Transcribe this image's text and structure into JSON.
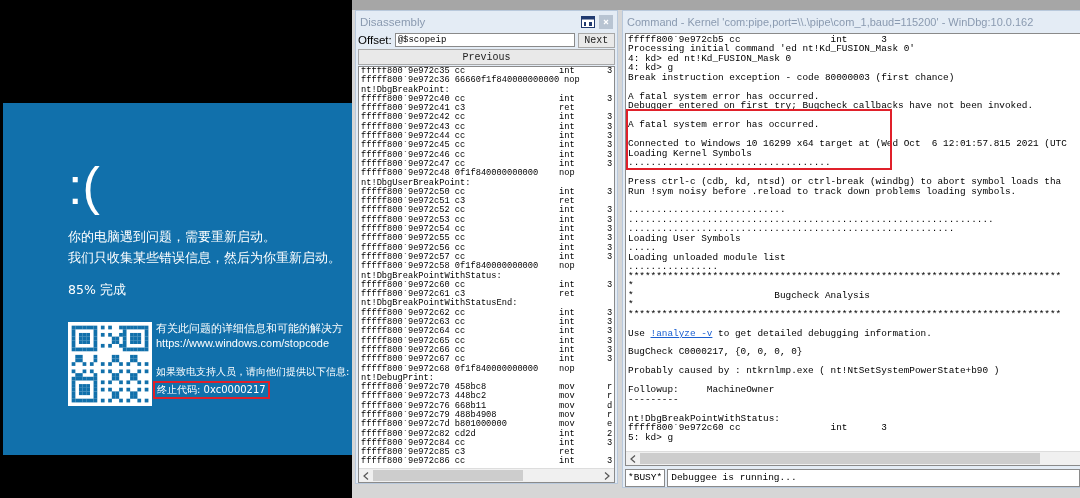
{
  "bsod": {
    "face": ":(",
    "message": [
      "你的电脑遇到问题，需要重新启动。",
      "我们只收集某些错误信息，然后为你重新启动。"
    ],
    "progress": "85% 完成",
    "info": "有关此问题的详细信息和可能的解决方",
    "url": "https://www.windows.com/stopcode",
    "support": "如果致电支持人员，请向他们提供以下信息:",
    "stop_code": {
      "text": "终止代码: 0xc0000217",
      "boxed": true
    }
  },
  "disassembly": {
    "title": "Disassembly",
    "offset_label": "Offset:",
    "offset_value": "@$scopeip",
    "next": "Next",
    "previous": "Previous",
    "rows": [
      {
        "kind": "code",
        "code": "fffff800`9e972c35 cc",
        "op": "int",
        "arg": "3"
      },
      {
        "kind": "code",
        "code": "fffff800`9e972c36 66660f1f840000000000",
        "op": "nop"
      },
      {
        "kind": "label",
        "code": "nt!DbgBreakPoint:"
      },
      {
        "kind": "code",
        "code": "fffff800`9e972c40 cc",
        "op": "int",
        "arg": "3"
      },
      {
        "kind": "code",
        "code": "fffff800`9e972c41 c3",
        "op": "ret"
      },
      {
        "kind": "code",
        "code": "fffff800`9e972c42 cc",
        "op": "int",
        "arg": "3"
      },
      {
        "kind": "code",
        "code": "fffff800`9e972c43 cc",
        "op": "int",
        "arg": "3"
      },
      {
        "kind": "code",
        "code": "fffff800`9e972c44 cc",
        "op": "int",
        "arg": "3"
      },
      {
        "kind": "code",
        "code": "fffff800`9e972c45 cc",
        "op": "int",
        "arg": "3"
      },
      {
        "kind": "code",
        "code": "fffff800`9e972c46 cc",
        "op": "int",
        "arg": "3"
      },
      {
        "kind": "code",
        "code": "fffff800`9e972c47 cc",
        "op": "int",
        "arg": "3"
      },
      {
        "kind": "code",
        "code": "fffff800`9e972c48 0f1f840000000000",
        "op": "nop"
      },
      {
        "kind": "label",
        "code": "nt!DbgUserBreakPoint:"
      },
      {
        "kind": "code",
        "code": "fffff800`9e972c50 cc",
        "op": "int",
        "arg": "3"
      },
      {
        "kind": "code",
        "code": "fffff800`9e972c51 c3",
        "op": "ret"
      },
      {
        "kind": "code",
        "code": "fffff800`9e972c52 cc",
        "op": "int",
        "arg": "3"
      },
      {
        "kind": "code",
        "code": "fffff800`9e972c53 cc",
        "op": "int",
        "arg": "3"
      },
      {
        "kind": "code",
        "code": "fffff800`9e972c54 cc",
        "op": "int",
        "arg": "3"
      },
      {
        "kind": "code",
        "code": "fffff800`9e972c55 cc",
        "op": "int",
        "arg": "3"
      },
      {
        "kind": "code",
        "code": "fffff800`9e972c56 cc",
        "op": "int",
        "arg": "3"
      },
      {
        "kind": "code",
        "code": "fffff800`9e972c57 cc",
        "op": "int",
        "arg": "3"
      },
      {
        "kind": "code",
        "code": "fffff800`9e972c58 0f1f840000000000",
        "op": "nop"
      },
      {
        "kind": "label",
        "code": "nt!DbgBreakPointWithStatus:"
      },
      {
        "kind": "code",
        "code": "fffff800`9e972c60 cc",
        "op": "int",
        "arg": "3"
      },
      {
        "kind": "code",
        "code": "fffff800`9e972c61 c3",
        "op": "ret"
      },
      {
        "kind": "label",
        "code": "nt!DbgBreakPointWithStatusEnd:"
      },
      {
        "kind": "code",
        "code": "fffff800`9e972c62 cc",
        "op": "int",
        "arg": "3"
      },
      {
        "kind": "code",
        "code": "fffff800`9e972c63 cc",
        "op": "int",
        "arg": "3"
      },
      {
        "kind": "code",
        "code": "fffff800`9e972c64 cc",
        "op": "int",
        "arg": "3"
      },
      {
        "kind": "code",
        "code": "fffff800`9e972c65 cc",
        "op": "int",
        "arg": "3"
      },
      {
        "kind": "code",
        "code": "fffff800`9e972c66 cc",
        "op": "int",
        "arg": "3"
      },
      {
        "kind": "code",
        "code": "fffff800`9e972c67 cc",
        "op": "int",
        "arg": "3"
      },
      {
        "kind": "code",
        "code": "fffff800`9e972c68 0f1f840000000000",
        "op": "nop"
      },
      {
        "kind": "label",
        "code": "nt!DebugPrint:"
      },
      {
        "kind": "code",
        "code": "fffff800`9e972c70 458bc8",
        "op": "mov",
        "arg": "r"
      },
      {
        "kind": "code",
        "code": "fffff800`9e972c73 448bc2",
        "op": "mov",
        "arg": "r"
      },
      {
        "kind": "code",
        "code": "fffff800`9e972c76 668b11",
        "op": "mov",
        "arg": "d"
      },
      {
        "kind": "code",
        "code": "fffff800`9e972c79 488b4908",
        "op": "mov",
        "arg": "r"
      },
      {
        "kind": "code",
        "code": "fffff800`9e972c7d b801000000",
        "op": "mov",
        "arg": "e"
      },
      {
        "kind": "code",
        "code": "fffff800`9e972c82 cd2d",
        "op": "int",
        "arg": "2"
      },
      {
        "kind": "code",
        "code": "fffff800`9e972c84 cc",
        "op": "int",
        "arg": "3"
      },
      {
        "kind": "code",
        "code": "fffff800`9e972c85 c3",
        "op": "ret"
      },
      {
        "kind": "code",
        "code": "fffff800`9e972c86 cc",
        "op": "int",
        "arg": "3"
      }
    ]
  },
  "command": {
    "title": "Command - Kernel 'com:pipe,port=\\\\.\\pipe\\com_1,baud=115200' - WinDbg:10.0.162",
    "lines": [
      {
        "kind": "text",
        "text": "fffff800`9e972cb5 cc                int      3",
        "boxed": false
      },
      {
        "kind": "text",
        "text": "Processing initial command 'ed nt!Kd_FUSION_Mask 0'",
        "boxed": false
      },
      {
        "kind": "text",
        "text": "4: kd> ed nt!Kd_FUSION_Mask 0",
        "boxed": false
      },
      {
        "kind": "text",
        "text": "4: kd> g",
        "boxed": false
      },
      {
        "kind": "text",
        "text": "Break instruction exception - code 80000003 (first chance)",
        "boxed": false
      },
      {
        "kind": "blank",
        "boxed": false
      },
      {
        "kind": "text",
        "text": "A fatal system error has occurred.",
        "boxed": false
      },
      {
        "kind": "text",
        "text": "Debugger entered on first try; Bugcheck callbacks have not been invoked.",
        "boxed": false
      },
      {
        "kind": "blank",
        "boxed": true
      },
      {
        "kind": "text",
        "text": "A fatal system error has occurred.",
        "boxed": true
      },
      {
        "kind": "blank",
        "boxed": true
      },
      {
        "kind": "text",
        "text": "Connected to Windows 10 16299 x64 target at (Wed Oct  6 12:01:57.815 2021 (UTC",
        "boxed": true
      },
      {
        "kind": "text",
        "text": "Loading Kernel Symbols",
        "boxed": true
      },
      {
        "kind": "text",
        "text": "....................................",
        "boxed": true
      },
      {
        "kind": "blank",
        "boxed": false
      },
      {
        "kind": "text",
        "text": "Press ctrl-c (cdb, kd, ntsd) or ctrl-break (windbg) to abort symbol loads tha",
        "boxed": false
      },
      {
        "kind": "text",
        "text": "Run !sym noisy before .reload to track down problems loading symbols.",
        "boxed": false
      },
      {
        "kind": "blank",
        "boxed": false
      },
      {
        "kind": "text",
        "text": "............................",
        "boxed": false
      },
      {
        "kind": "text",
        "text": ".................................................................",
        "boxed": false
      },
      {
        "kind": "text",
        "text": "..........................................................",
        "boxed": false
      },
      {
        "kind": "text",
        "text": "Loading User Symbols",
        "boxed": false
      },
      {
        "kind": "text",
        "text": ".....",
        "boxed": false
      },
      {
        "kind": "text",
        "text": "Loading unloaded module list",
        "boxed": false
      },
      {
        "kind": "text",
        "text": "................",
        "boxed": false
      },
      {
        "kind": "text",
        "text": "*****************************************************************************",
        "boxed": false
      },
      {
        "kind": "text",
        "text": "*",
        "boxed": false
      },
      {
        "kind": "text",
        "text": "*                         Bugcheck Analysis",
        "boxed": false
      },
      {
        "kind": "text",
        "text": "*",
        "boxed": false
      },
      {
        "kind": "text",
        "text": "*****************************************************************************",
        "boxed": false
      },
      {
        "kind": "blank",
        "boxed": false
      },
      {
        "kind": "link",
        "before": "Use ",
        "link": "!analyze -v",
        "after": " to get detailed debugging information.",
        "boxed": false
      },
      {
        "kind": "blank",
        "boxed": false
      },
      {
        "kind": "text",
        "text": "BugCheck C0000217, {0, 0, 0, 0}",
        "boxed": false
      },
      {
        "kind": "blank",
        "boxed": false
      },
      {
        "kind": "text",
        "text": "Probably caused by : ntkrnlmp.exe ( nt!NtSetSystemPowerState+b90 )",
        "boxed": false
      },
      {
        "kind": "blank",
        "boxed": false
      },
      {
        "kind": "text",
        "text": "Followup:     MachineOwner",
        "boxed": false
      },
      {
        "kind": "text",
        "text": "---------",
        "boxed": false
      },
      {
        "kind": "blank",
        "boxed": false
      },
      {
        "kind": "text",
        "text": "nt!DbgBreakPointWithStatus:",
        "boxed": false
      },
      {
        "kind": "text",
        "text": "fffff800`9e972c60 cc                int      3",
        "boxed": false
      },
      {
        "kind": "text",
        "text": "5: kd> g",
        "boxed": false
      }
    ],
    "status": {
      "busy": "*BUSY*",
      "message": "Debuggee is running..."
    }
  }
}
